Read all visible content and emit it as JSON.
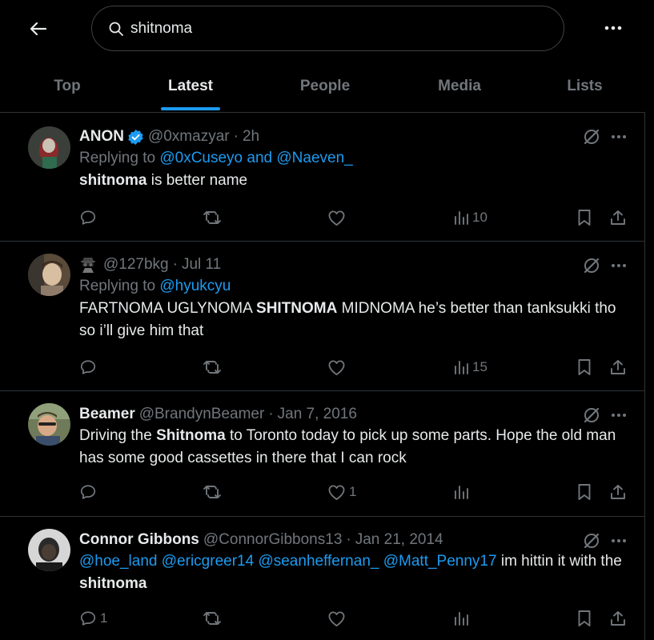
{
  "header": {
    "back_icon": "arrow-left-icon",
    "search_icon": "search-icon",
    "search_query": "shitnoma",
    "more_icon": "more-horizontal-icon"
  },
  "tabs": [
    {
      "label": "Top",
      "active": false
    },
    {
      "label": "Latest",
      "active": true
    },
    {
      "label": "People",
      "active": false
    },
    {
      "label": "Media",
      "active": false
    },
    {
      "label": "Lists",
      "active": false
    }
  ],
  "colors": {
    "accent": "#1d9bf0",
    "background": "#000000",
    "text": "#e7e9ea",
    "muted": "#71767b",
    "border": "#2f3336"
  },
  "tweets": [
    {
      "name": "ANON",
      "verified": true,
      "handle": "@0xmazyar",
      "time": "2h",
      "reply_prefix": "Replying to",
      "reply_mentions": [
        "@0xCuseyo",
        "@Naeven_"
      ],
      "reply_joiner": "and",
      "text_bold": "shitnoma",
      "text_rest": " is better name",
      "replies": "",
      "retweets": "",
      "likes": "",
      "views": "10"
    },
    {
      "name_emoji": "spy-emoji",
      "handle": "@127bkg",
      "time": "Jul 11",
      "reply_prefix": "Replying to",
      "reply_mentions": [
        "@hyukcyu"
      ],
      "text_pre": "FARTNOMA UGLYNOMA ",
      "text_bold": "SHITNOMA",
      "text_rest": " MIDNOMA he’s better than tanksukki tho so i’ll give him that",
      "replies": "",
      "retweets": "",
      "likes": "",
      "views": "15"
    },
    {
      "name": "Beamer",
      "handle": "@BrandynBeamer",
      "time": "Jan 7, 2016",
      "text_pre": "Driving the ",
      "text_bold": "Shitnoma",
      "text_rest": " to Toronto today to pick up some parts. Hope the old man has some good cassettes in there that I can rock",
      "replies": "",
      "retweets": "",
      "likes": "1",
      "views": ""
    },
    {
      "name": "Connor Gibbons",
      "handle": "@ConnorGibbons13",
      "time": "Jan 21, 2014",
      "mentions": [
        "@hoe_land",
        "@ericgreer14",
        "@seanheffernan_",
        "@Matt_Penny17"
      ],
      "text_mid": " im hittin it with the ",
      "text_bold": "shitnoma",
      "replies": "1",
      "retweets": "",
      "likes": "",
      "views": ""
    }
  ]
}
